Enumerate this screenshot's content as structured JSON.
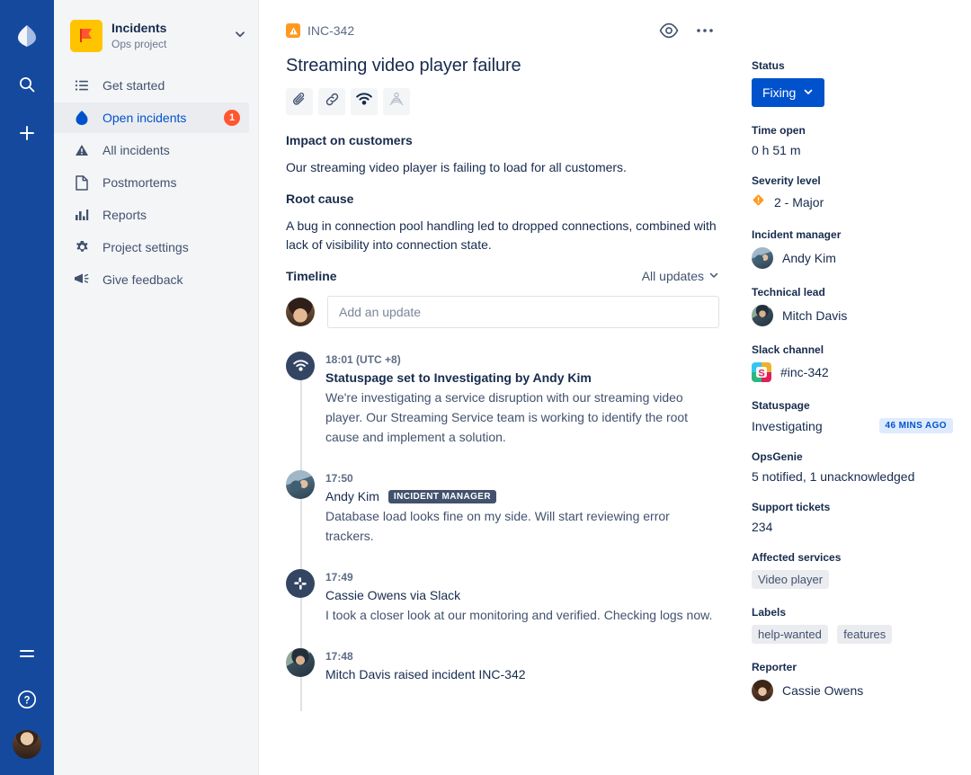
{
  "rail": {
    "logo_icon": "opsgenie-logo-icon",
    "items": [
      {
        "icon": "search-icon",
        "name": "search"
      },
      {
        "icon": "plus-icon",
        "name": "create"
      }
    ],
    "bottom": [
      {
        "icon": "menu-icon",
        "name": "menu"
      },
      {
        "icon": "help-icon",
        "name": "help"
      },
      {
        "icon": "avatar",
        "name": "profile-avatar"
      }
    ]
  },
  "sidebar": {
    "project": {
      "name": "Incidents",
      "subtitle": "Ops project",
      "icon": "flag-icon",
      "icon_bg": "#FFC400",
      "chevron": "chevron-down-icon"
    },
    "items": [
      {
        "label": "Get started",
        "icon": "list-icon",
        "active": false,
        "badge": ""
      },
      {
        "label": "Open incidents",
        "icon": "flame-icon",
        "active": true,
        "badge": "1"
      },
      {
        "label": "All incidents",
        "icon": "triangle-alert-icon",
        "active": false,
        "badge": ""
      },
      {
        "label": "Postmortems",
        "icon": "document-icon",
        "active": false,
        "badge": ""
      },
      {
        "label": "Reports",
        "icon": "bar-chart-icon",
        "active": false,
        "badge": ""
      },
      {
        "label": "Project settings",
        "icon": "gear-icon",
        "active": false,
        "badge": ""
      },
      {
        "label": "Give feedback",
        "icon": "megaphone-icon",
        "active": false,
        "badge": ""
      }
    ]
  },
  "content": {
    "breadcrumb": "INC-342",
    "breadcrumb_icon": "incident-icon",
    "title": "Streaming video player failure",
    "top_actions": [
      {
        "icon": "watch-eye-icon",
        "name": "watch-button"
      },
      {
        "icon": "more-dots-icon",
        "name": "more-actions-button"
      }
    ],
    "action_buttons": [
      {
        "icon": "paperclip-icon",
        "name": "attach-button"
      },
      {
        "icon": "link-icon",
        "name": "link-button"
      },
      {
        "icon": "alert-signal-icon",
        "name": "alert-button"
      },
      {
        "icon": "broadcast-person-icon",
        "name": "notify-button"
      }
    ],
    "sections": [
      {
        "heading": "Impact on customers",
        "body": "Our streaming video player is failing to load for all customers."
      },
      {
        "heading": "Root cause",
        "body": "A bug in connection pool handling led to dropped connections, combined with lack of visibility into connection state."
      }
    ],
    "timeline": {
      "title": "Timeline",
      "filter_label": "All updates",
      "input_placeholder": "Add an update",
      "input_value": "",
      "entries": [
        {
          "time": "18:01 (UTC +8)",
          "avatar_type": "system",
          "avatar_icon": "statuspage-icon",
          "author": "Statuspage set to Investigating by Andy Kim",
          "author_bold": true,
          "tag": "",
          "text": "We're investigating a service disruption with our streaming video player. Our Streaming Service team is working to identify the root cause and implement a solution."
        },
        {
          "time": "17:50",
          "avatar_type": "photo",
          "avatar_icon": "user-avatar",
          "author": "Andy Kim",
          "author_bold": false,
          "tag": "INCIDENT MANAGER",
          "text": "Database load looks fine on my side. Will start reviewing error trackers."
        },
        {
          "time": "17:49",
          "avatar_type": "system",
          "avatar_icon": "slack-icon",
          "author": "Cassie Owens via Slack",
          "author_bold": false,
          "tag": "",
          "text": "I took a closer look at our monitoring and verified. Checking logs now."
        },
        {
          "time": "17:48",
          "avatar_type": "photo",
          "avatar_icon": "user-avatar",
          "author": "Mitch Davis raised incident INC-342",
          "author_bold": false,
          "tag": "",
          "text": ""
        }
      ]
    }
  },
  "details": {
    "status": {
      "label": "Status",
      "value": "Fixing",
      "color": "#0052CC",
      "chevron": "chevron-down-icon"
    },
    "time_open": {
      "label": "Time open",
      "value": "0 h  51 m"
    },
    "severity": {
      "label": "Severity level",
      "value": "2 - Major",
      "icon": "severity-major-icon",
      "icon_color": "#FF991F"
    },
    "incident_manager": {
      "label": "Incident manager",
      "value": "Andy Kim"
    },
    "technical_lead": {
      "label": "Technical lead",
      "value": "Mitch Davis"
    },
    "slack_channel": {
      "label": "Slack channel",
      "value": "#inc-342",
      "icon": "slack-icon"
    },
    "statuspage": {
      "label": "Statuspage",
      "value": "Investigating",
      "badge": "46 MINS AGO"
    },
    "opsgenie": {
      "label": "OpsGenie",
      "value": "5 notified, 1 unacknowledged"
    },
    "support_tickets": {
      "label": "Support tickets",
      "value": "234"
    },
    "affected_services": {
      "label": "Affected services",
      "chips": [
        "Video player"
      ]
    },
    "labels": {
      "label": "Labels",
      "chips": [
        "help-wanted",
        "features"
      ]
    },
    "reporter": {
      "label": "Reporter",
      "value": "Cassie Owens"
    }
  }
}
